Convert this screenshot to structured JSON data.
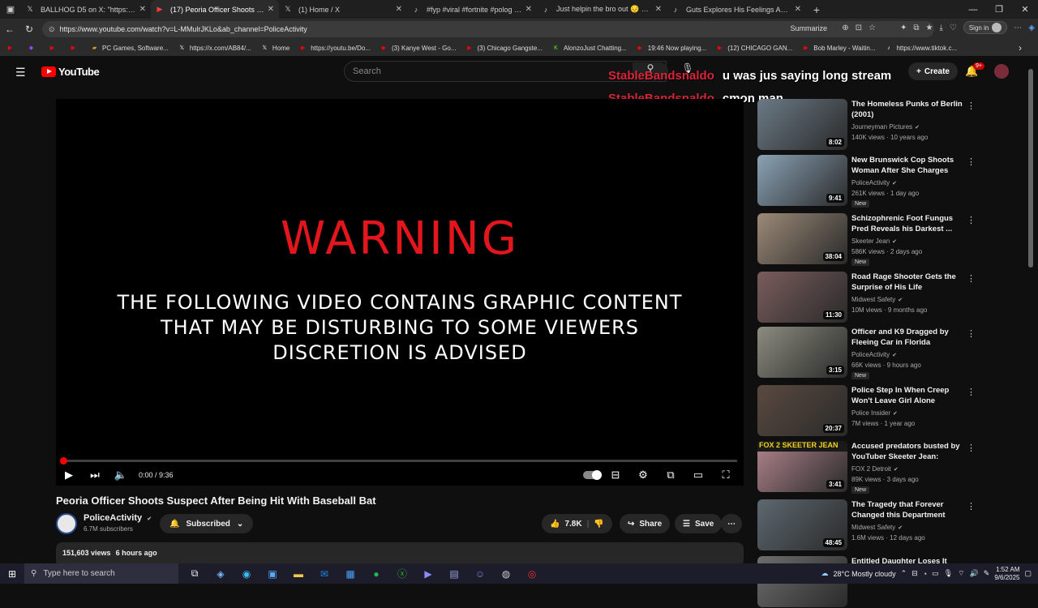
{
  "browser": {
    "tabs": [
      {
        "title": "BALLHOG D5 on X: \"https://t.co/v",
        "icon": "x-logo-icon"
      },
      {
        "title": "(17) Peoria Officer Shoots Su",
        "icon": "youtube-icon",
        "active": true
      },
      {
        "title": "(1) Home / X",
        "icon": "x-logo-icon"
      },
      {
        "title": "#fyp #viral #fortnite #polog #be",
        "icon": "tiktok-icon"
      },
      {
        "title": "Just helpin the bro out 😔 #fyp",
        "icon": "tiktok-icon"
      },
      {
        "title": "Guts Explores His Feelings About",
        "icon": "tiktok-icon"
      }
    ],
    "url": "https://www.youtube.com/watch?v=L-MMulrJKLo&ab_channel=PoliceActivity",
    "summarize_label": "Summarize",
    "signin_label": "Sign in",
    "bookmarks": [
      {
        "label": "",
        "icon": "youtube-icon",
        "color": "#ff0000"
      },
      {
        "label": "",
        "icon": "twitch-icon",
        "color": "#9146ff"
      },
      {
        "label": "",
        "icon": "youtube-icon",
        "color": "#ff0000"
      },
      {
        "label": "",
        "icon": "youtube-icon",
        "color": "#ff0000"
      },
      {
        "label": "PC Games, Software...",
        "icon": "folder-icon",
        "color": "#c9a227"
      },
      {
        "label": "https://x.com/AB84/...",
        "icon": "x-logo-icon",
        "color": "#ffffff"
      },
      {
        "label": "Home",
        "icon": "x-logo-icon",
        "color": "#ffffff"
      },
      {
        "label": "https://youtu.be/Do...",
        "icon": "youtube-icon",
        "color": "#ff0000"
      },
      {
        "label": "(3) Kanye West - Go...",
        "icon": "youtube-icon",
        "color": "#ff0000"
      },
      {
        "label": "(3) Chicago Gangste...",
        "icon": "youtube-icon",
        "color": "#ff0000"
      },
      {
        "label": "AlonzoJust Chatting...",
        "icon": "kick-icon",
        "color": "#53fc18"
      },
      {
        "label": "19:46 Now playing...",
        "icon": "youtube-icon",
        "color": "#ff0000"
      },
      {
        "label": "(12) CHICAGO GAN...",
        "icon": "youtube-icon",
        "color": "#ff0000"
      },
      {
        "label": "Bob Marley - Waitin...",
        "icon": "youtube-icon",
        "color": "#ff0000"
      },
      {
        "label": "https://www.tiktok.c...",
        "icon": "tiktok-icon",
        "color": "#ffffff"
      }
    ]
  },
  "youtube": {
    "logo_text": "YouTube",
    "search_placeholder": "Search",
    "create_label": "Create",
    "notif_count": "9+",
    "chat": [
      {
        "user": "StableBandsnaldo",
        "message": "u was jus saying long stream"
      },
      {
        "user": "StableBandsnaldo",
        "message": "cmon man"
      }
    ],
    "player": {
      "warning_title": "WARNING",
      "warning_line1": "THE FOLLOWING VIDEO CONTAINS GRAPHIC CONTENT",
      "warning_line2": "THAT MAY BE DISTURBING TO SOME VIEWERS",
      "warning_line3": "DISCRETION IS ADVISED",
      "time": "0:00 / 9:36",
      "progress": 0
    },
    "video": {
      "title": "Peoria Officer Shoots Suspect After Being Hit With Baseball Bat",
      "channel": "PoliceActivity",
      "subscribers": "6.7M subscribers",
      "subscribed_label": "Subscribed",
      "likes": "7.8K",
      "share_label": "Share",
      "save_label": "Save",
      "views": "151,603 views",
      "age": "6 hours ago"
    },
    "recommendations": [
      {
        "title": "The Homeless Punks of Berlin (2001)",
        "channel": "Journeyman Pictures",
        "meta": "140K views · 10 years ago",
        "duration": "8:02",
        "new": "",
        "thumb": "#6b7a86"
      },
      {
        "title": "New Brunswick Cop Shoots Woman After She Charges Wit...",
        "channel": "PoliceActivity",
        "meta": "261K views · 1 day ago",
        "duration": "9:41",
        "new": "New",
        "thumb": "#8aa3b5"
      },
      {
        "title": "Schizophrenic Foot Fungus Pred Reveals his Darkest ...",
        "channel": "Skeeter Jean",
        "meta": "586K views · 2 days ago",
        "duration": "38:04",
        "new": "New",
        "thumb": "#9c8a78"
      },
      {
        "title": "Road Rage Shooter Gets the Surprise of His Life",
        "channel": "Midwest Safety",
        "meta": "10M views · 9 months ago",
        "duration": "11:30",
        "new": "",
        "thumb": "#7a5c5c"
      },
      {
        "title": "Officer and K9 Dragged by Fleeing Car in Florida",
        "channel": "PoliceActivity",
        "meta": "66K views · 9 hours ago",
        "duration": "3:15",
        "new": "New",
        "thumb": "#8c8c80"
      },
      {
        "title": "Police Step In When Creep Won't Leave Girl Alone",
        "channel": "Police Insider",
        "meta": "7M views · 1 year ago",
        "duration": "20:37",
        "new": "",
        "thumb": "#5a4a40"
      },
      {
        "title": "Accused predators busted by YouTuber Skeeter Jean: \"We're...",
        "channel": "FOX 2 Detroit",
        "meta": "89K views · 3 days ago",
        "duration": "3:41",
        "new": "New",
        "thumb": "#b0848c"
      },
      {
        "title": "The Tragedy that Forever Changed this Department",
        "channel": "Midwest Safety",
        "meta": "1.6M views · 12 days ago",
        "duration": "48:45",
        "new": "",
        "thumb": "#5d6870"
      },
      {
        "title": "Entitled Daughter Loses It When...",
        "channel": "",
        "meta": "",
        "duration": "",
        "new": "",
        "thumb": "#6d6d6d"
      }
    ],
    "fox_banner": "FOX 2 SKEETER JEAN"
  },
  "taskbar": {
    "search_placeholder": "Type here to search",
    "weather": "28°C  Mostly cloudy",
    "time": "1:52 AM",
    "date": "9/6/2025"
  }
}
